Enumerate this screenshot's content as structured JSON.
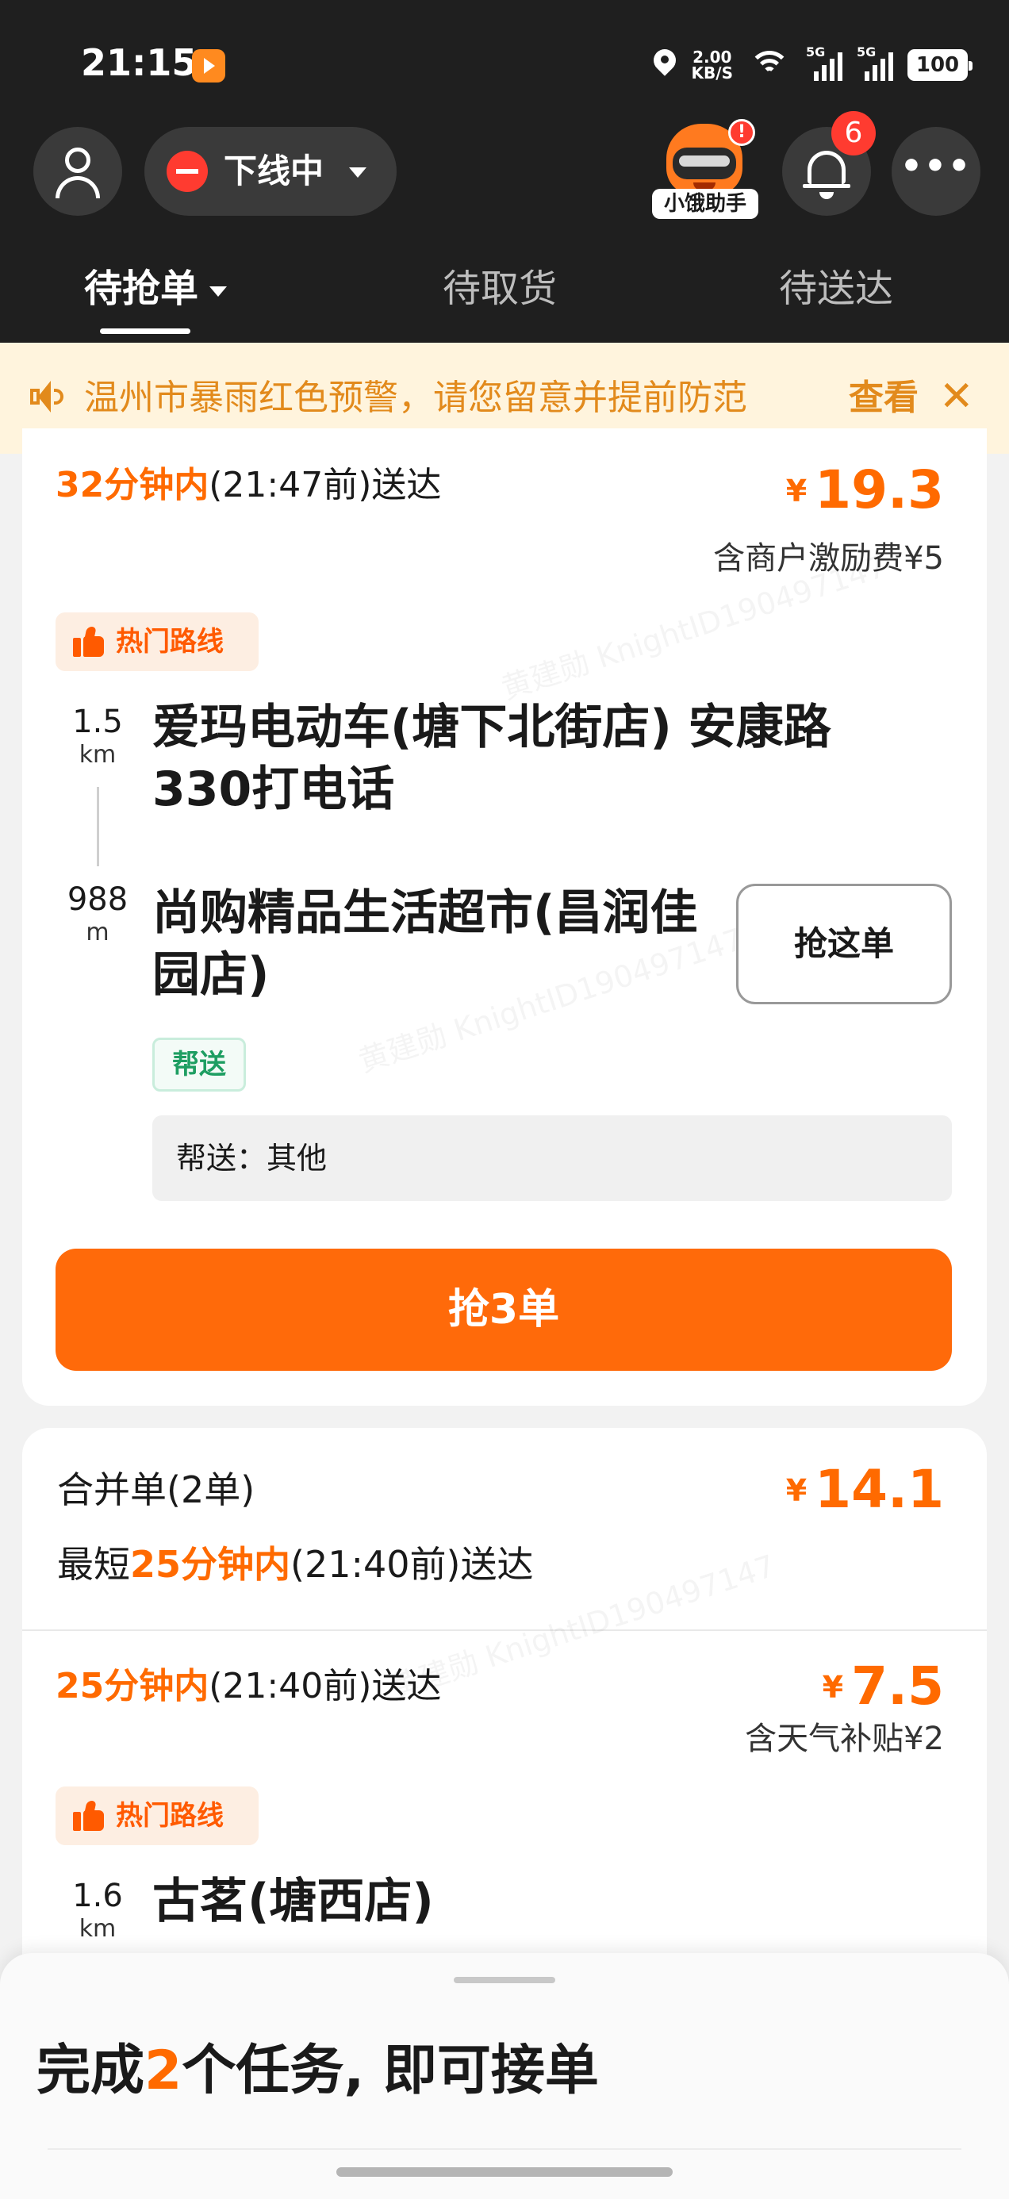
{
  "status_bar": {
    "time": "21:15",
    "net_speed_value": "2.00",
    "net_speed_unit": "KB/S",
    "sim1": "5G",
    "sim2": "5G",
    "battery": "100"
  },
  "header": {
    "online_status": "下线中",
    "assistant_label": "小饿助手",
    "assistant_badge": "!",
    "notification_count": "6",
    "more": "•••"
  },
  "tabs": [
    {
      "label": "待抢单",
      "active": true
    },
    {
      "label": "待取货",
      "active": false
    },
    {
      "label": "待送达",
      "active": false
    }
  ],
  "notice": {
    "text": "温州市暴雨红色预警，请您留意并提前防范",
    "action": "查看",
    "close": "✕"
  },
  "orders": [
    {
      "eta_highlight": "32分钟内",
      "eta_rest": "(21:47前)送达",
      "currency": "¥",
      "price": "19.3",
      "price_note": "含商户激励费¥5",
      "hot_label": "热门路线",
      "pickup_distance": "1.5",
      "pickup_unit": "km",
      "pickup_name": "爱玛电动车(塘下北街店) 安康路330打电话",
      "dropoff_distance": "988",
      "dropoff_unit": "m",
      "dropoff_name": "尚购精品生活超市(昌润佳园店)",
      "grab_label": "抢这单",
      "tag": "帮送",
      "remark": "帮送：其他",
      "grab_all_label": "抢3单"
    }
  ],
  "merged": {
    "title": "合并单(2单)",
    "currency": "¥",
    "price": "14.1",
    "eta_prefix": "最短",
    "eta_highlight": "25分钟内",
    "eta_rest": "(21:40前)送达",
    "sub_eta_highlight": "25分钟内",
    "sub_eta_rest": "(21:40前)送达",
    "sub_currency": "¥",
    "sub_price": "7.5",
    "sub_price_note": "含天气补贴¥2",
    "hot_label": "热门路线",
    "pickup_distance": "1.6",
    "pickup_unit": "km",
    "pickup_name": "古茗(塘西店)"
  },
  "sheet": {
    "title_prefix": "完成",
    "title_count": "2",
    "title_suffix": "个任务, 即可接单"
  },
  "watermark": "黄建勋 KnightID190497147",
  "colors": {
    "accent": "#ff6a00",
    "dark_header": "#1f1f1f",
    "notice_bg": "#fff4dd",
    "notice_text": "#e28a1c",
    "badge": "#ff3b30",
    "help_tag": "#1e9e62"
  },
  "icons": [
    "user-icon",
    "minus-circle-icon",
    "bell-icon",
    "more-icon",
    "speaker-icon",
    "close-icon",
    "thumbs-up-icon",
    "location-icon",
    "wifi-icon",
    "signal-icon",
    "battery-icon"
  ]
}
